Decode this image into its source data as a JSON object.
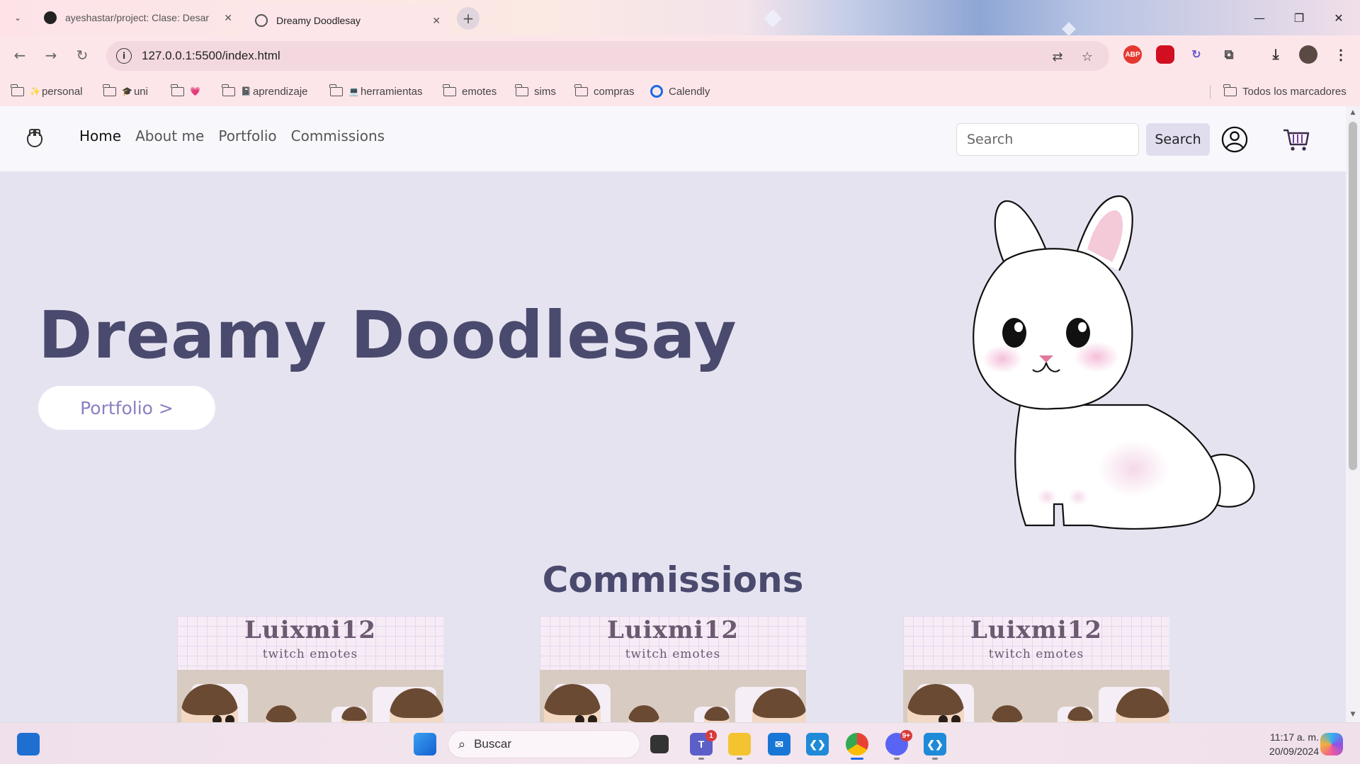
{
  "browser": {
    "tabs": [
      {
        "title": "ayeshastar/project: Clase: Desar",
        "active": false,
        "icon": "github-icon"
      },
      {
        "title": "Dreamy Doodlesay",
        "active": true,
        "icon": "globe-icon"
      }
    ],
    "url": "127.0.0.1:5500/index.html",
    "bookmarks": [
      {
        "emoji": "✨",
        "label": "personal"
      },
      {
        "emoji": "🎓",
        "label": "uni"
      },
      {
        "emoji": "💗",
        "label": ""
      },
      {
        "emoji": "📓",
        "label": "aprendizaje"
      },
      {
        "emoji": "💻",
        "label": "herramientas"
      },
      {
        "emoji": "",
        "label": "emotes"
      },
      {
        "emoji": "",
        "label": "sims"
      },
      {
        "emoji": "",
        "label": "compras"
      },
      {
        "emoji": "",
        "label": "Calendly"
      }
    ],
    "all_bookmarks_label": "Todos los marcadores",
    "extensions": [
      "ABP"
    ]
  },
  "page": {
    "nav": {
      "links": [
        "Home",
        "About me",
        "Portfolio",
        "Commissions"
      ],
      "active_link": "Home",
      "search_placeholder": "Search",
      "search_button": "Search"
    },
    "hero": {
      "title": "Dreamy Doodlesay",
      "button_label": "Portfolio >"
    },
    "commissions": {
      "title": "Commissions",
      "cards": [
        {
          "title": "Luixmi12",
          "subtitle": "twitch emotes"
        },
        {
          "title": "Luixmi12",
          "subtitle": "twitch emotes"
        },
        {
          "title": "Luixmi12",
          "subtitle": "twitch emotes"
        }
      ]
    }
  },
  "taskbar": {
    "search_placeholder": "Buscar",
    "time": "11:17 a. m.",
    "date": "20/09/2024",
    "teams_badge": "1",
    "discord_badge": "9+"
  },
  "colors": {
    "page_bg": "#e6e3f1",
    "title": "#4a4a6e",
    "accent": "#8a7fc2",
    "chrome": "#fde6ea"
  }
}
